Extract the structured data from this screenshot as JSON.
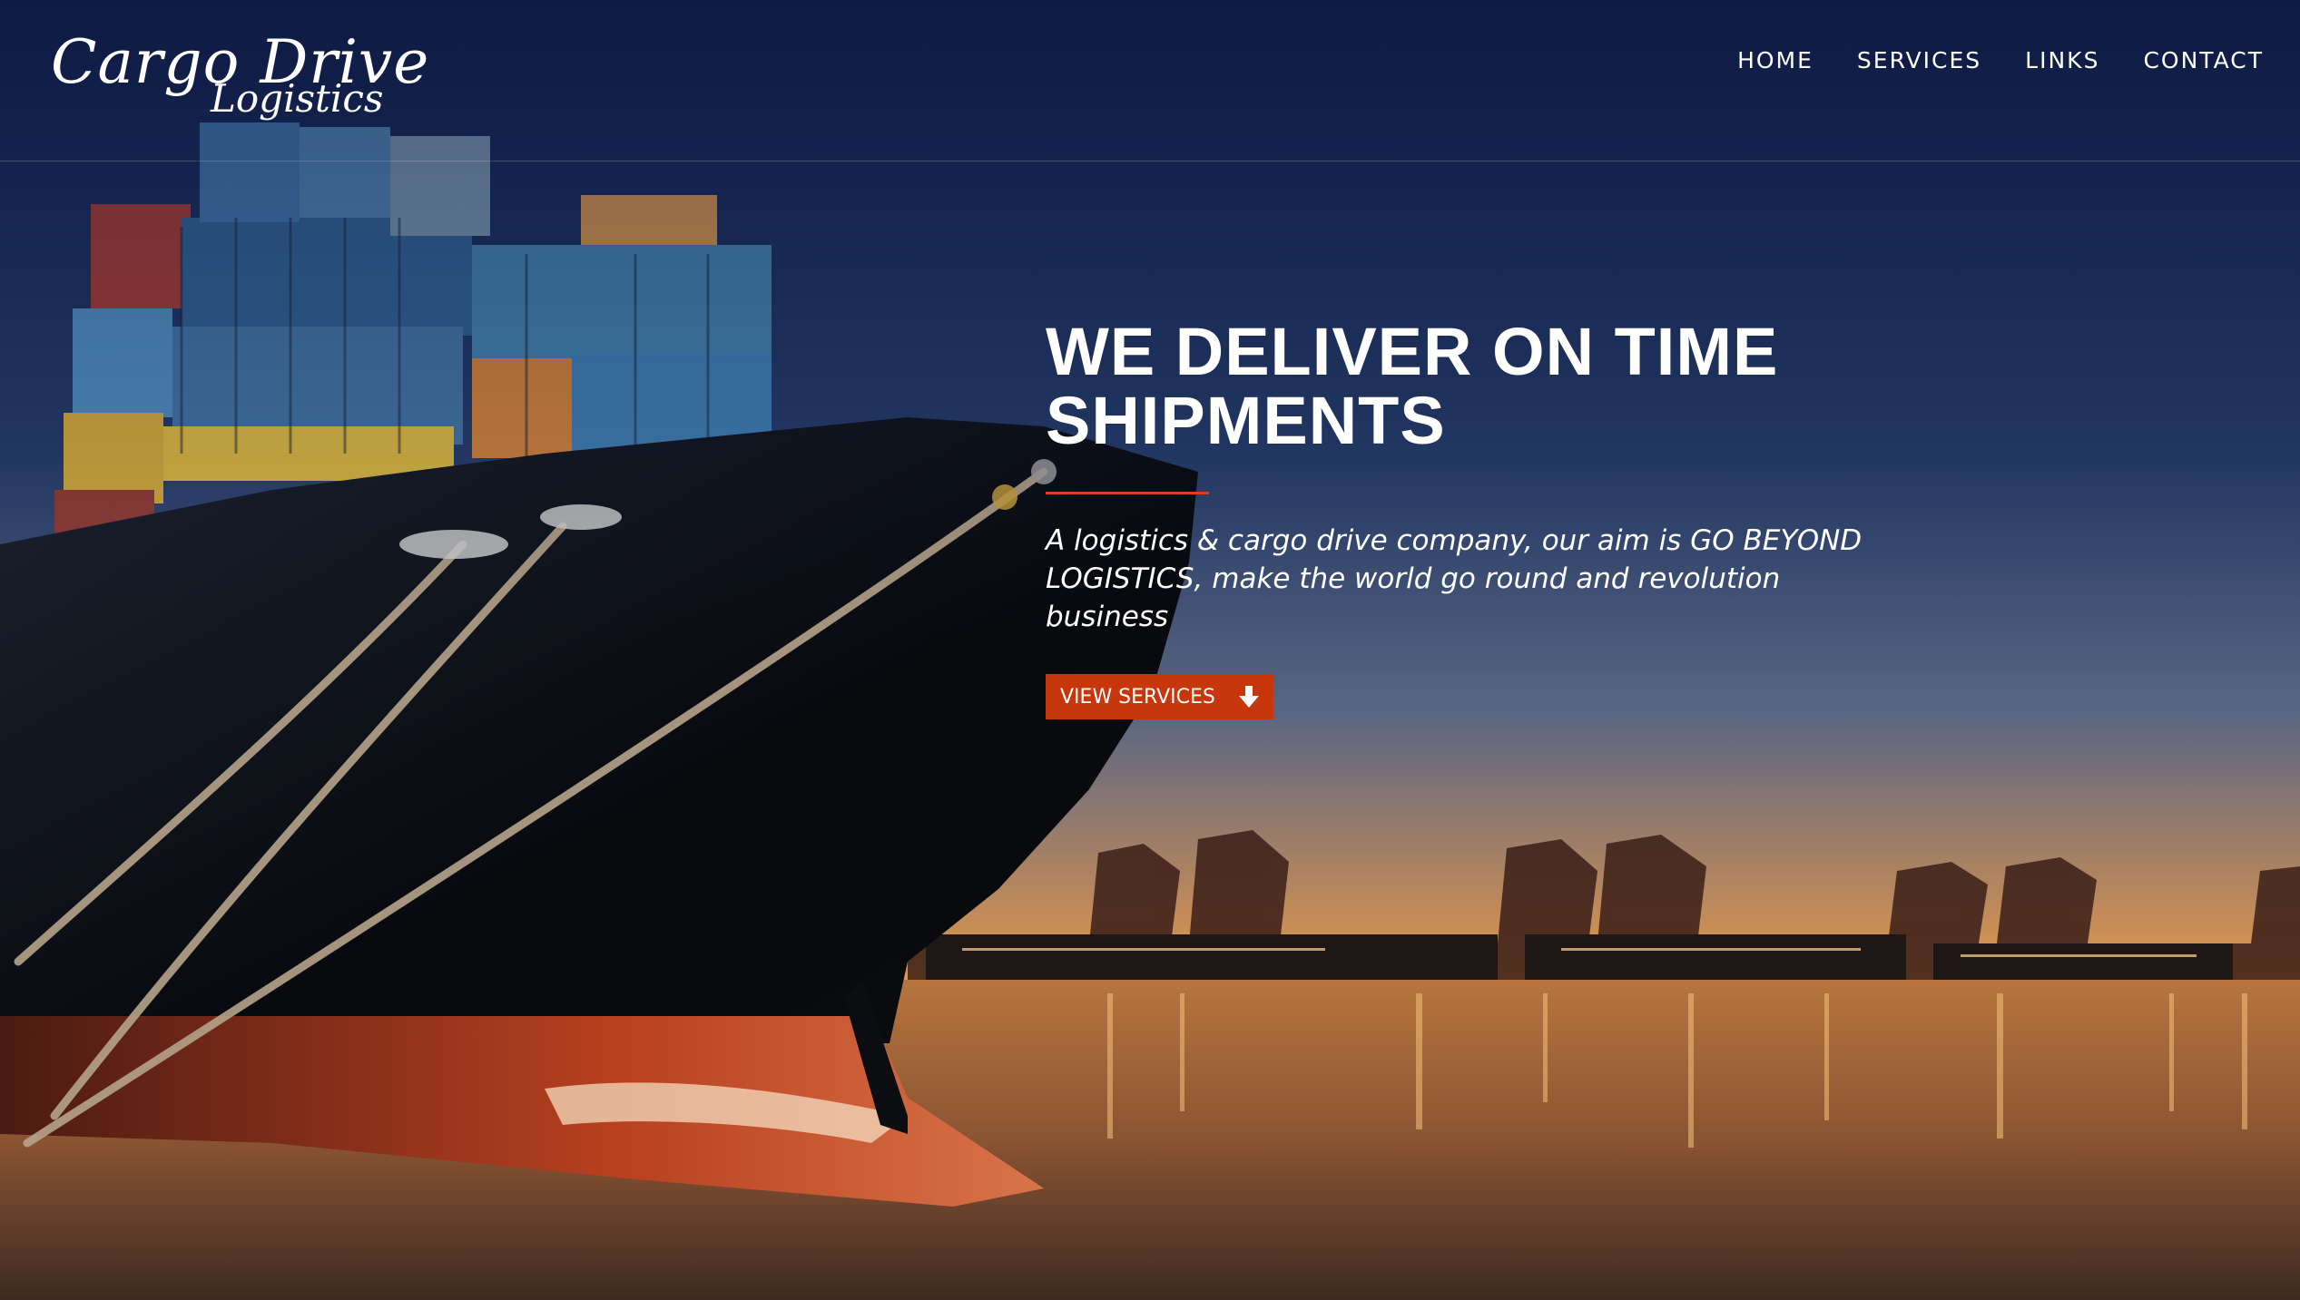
{
  "brand": {
    "name": "Cargo Drive",
    "sub": "Logistics"
  },
  "nav": {
    "items": [
      {
        "label": "HOME"
      },
      {
        "label": "SERVICES"
      },
      {
        "label": "LINKS"
      },
      {
        "label": "CONTACT"
      }
    ]
  },
  "hero": {
    "headline_line1": "WE DELIVER ON TIME",
    "headline_line2": "SHIPMENTS",
    "tagline": "A logistics & cargo drive company, our aim is GO BEYOND LOGISTICS, make the world go round and revolution business",
    "cta_label": "VIEW SERVICES",
    "cta_icon": "arrow-down-icon"
  },
  "colors": {
    "accent": "#c8360c",
    "sky_top": "#13234f",
    "sky_mid": "#3a4d74",
    "horizon": "#d98a45",
    "text": "#ffffff"
  }
}
